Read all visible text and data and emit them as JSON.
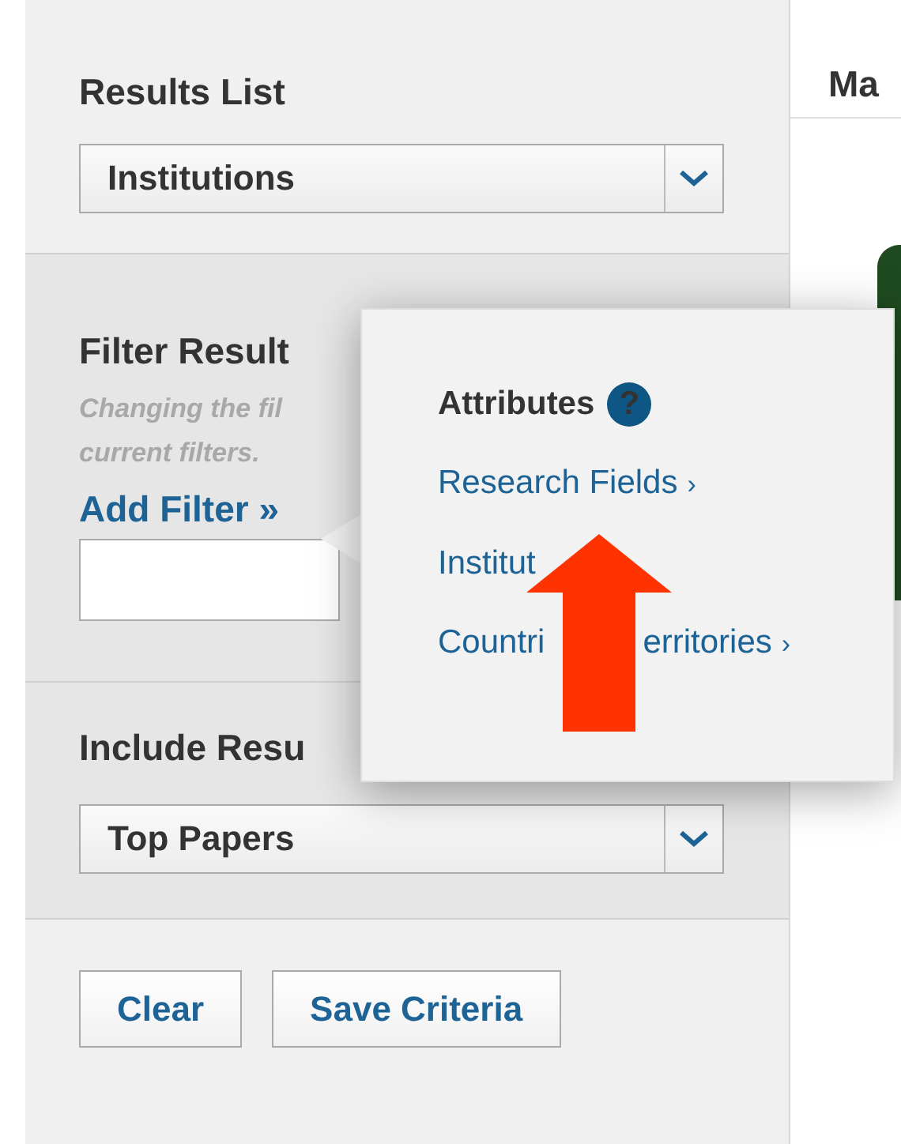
{
  "sidebar": {
    "results_list": {
      "heading": "Results List",
      "value": "Institutions"
    },
    "filter": {
      "heading": "Filter Result",
      "hint_lines": [
        "Changing the fil",
        "current filters."
      ],
      "add_filter": "Add Filter »"
    },
    "include": {
      "heading": "Include Resu",
      "value": "Top Papers"
    },
    "buttons": [
      "Clear",
      "Save Criteria"
    ]
  },
  "main": {
    "heading": "Ma"
  },
  "popup": {
    "title": "Attributes",
    "help": "?",
    "links": [
      {
        "text": "Research Fields",
        "chevron": "›"
      },
      {
        "text": "Institut"
      },
      {
        "text": "Countri",
        "after": "erritories",
        "chevron": "›"
      }
    ]
  }
}
